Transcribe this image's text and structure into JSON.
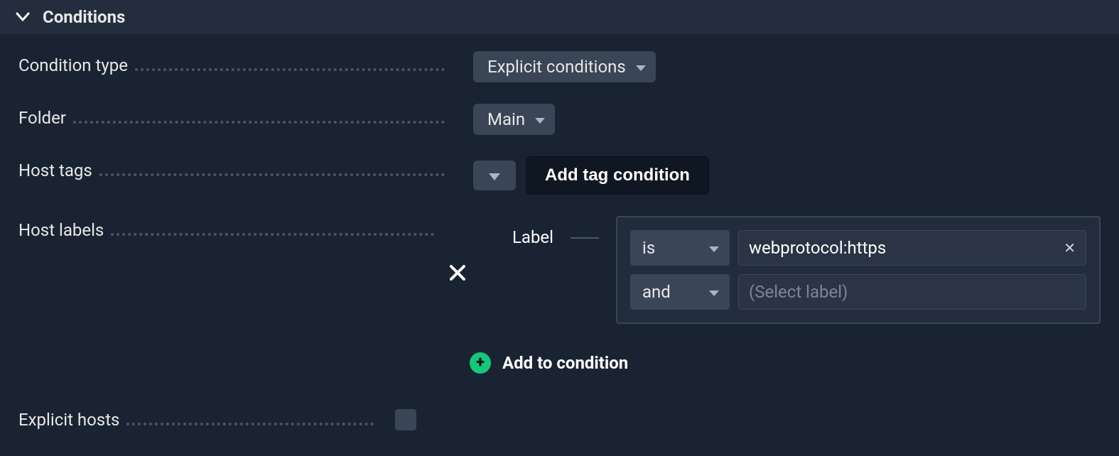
{
  "section": {
    "title": "Conditions"
  },
  "fields": {
    "condition_type": {
      "label": "Condition type",
      "value": "Explicit conditions"
    },
    "folder": {
      "label": "Folder",
      "value": "Main"
    },
    "host_tags": {
      "label": "Host tags",
      "button": "Add tag condition"
    },
    "host_labels": {
      "label": "Host labels",
      "group_label": "Label",
      "rows": [
        {
          "op": "is",
          "value": "webprotocol:https"
        },
        {
          "op": "and",
          "placeholder": "(Select label)"
        }
      ],
      "add_button": "Add to condition"
    },
    "explicit_hosts": {
      "label": "Explicit hosts"
    }
  }
}
